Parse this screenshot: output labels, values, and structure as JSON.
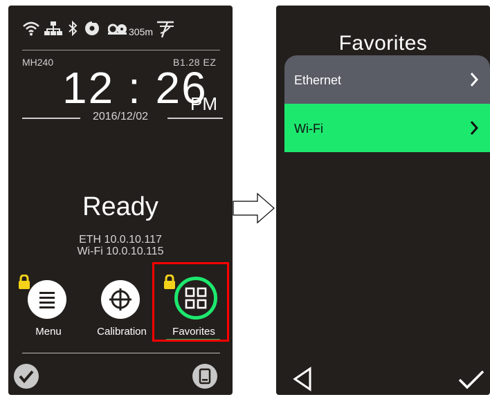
{
  "left_screen": {
    "status": {
      "icons": [
        "wifi-icon",
        "ethernet-icon",
        "bluetooth-icon",
        "ribbon-icon",
        "label-icon"
      ],
      "label_length": "305m",
      "brand_icon": "tsc-logo-icon"
    },
    "model": "MH240",
    "firmware": "B1.28 EZ",
    "time": "12 : 26",
    "ampm": "PM",
    "date": "2016/12/02",
    "status_text": "Ready",
    "eth_ip": "ETH 10.0.10.117",
    "wifi_ip": "Wi-Fi 10.0.10.115",
    "shortcuts": [
      {
        "label": "Menu",
        "icon": "menu-icon",
        "locked": true
      },
      {
        "label": "Calibration",
        "icon": "crosshair-icon",
        "locked": false
      },
      {
        "label": "Favorites",
        "icon": "grid-icon",
        "locked": true,
        "selected": true
      }
    ],
    "bottom": {
      "left_icon": "check-icon",
      "right_icon": "device-icon"
    }
  },
  "right_screen": {
    "title": "Favorites",
    "items": [
      {
        "label": "Ethernet",
        "bg": "#5a5c66"
      },
      {
        "label": "Wi-Fi",
        "bg": "#1de86e"
      }
    ],
    "bottom": {
      "left_icon": "back-icon",
      "right_icon": "check-icon"
    }
  },
  "colors": {
    "screen_bg": "#231f1c",
    "accent_green": "#1de86e",
    "highlight_red": "#ff0000"
  }
}
